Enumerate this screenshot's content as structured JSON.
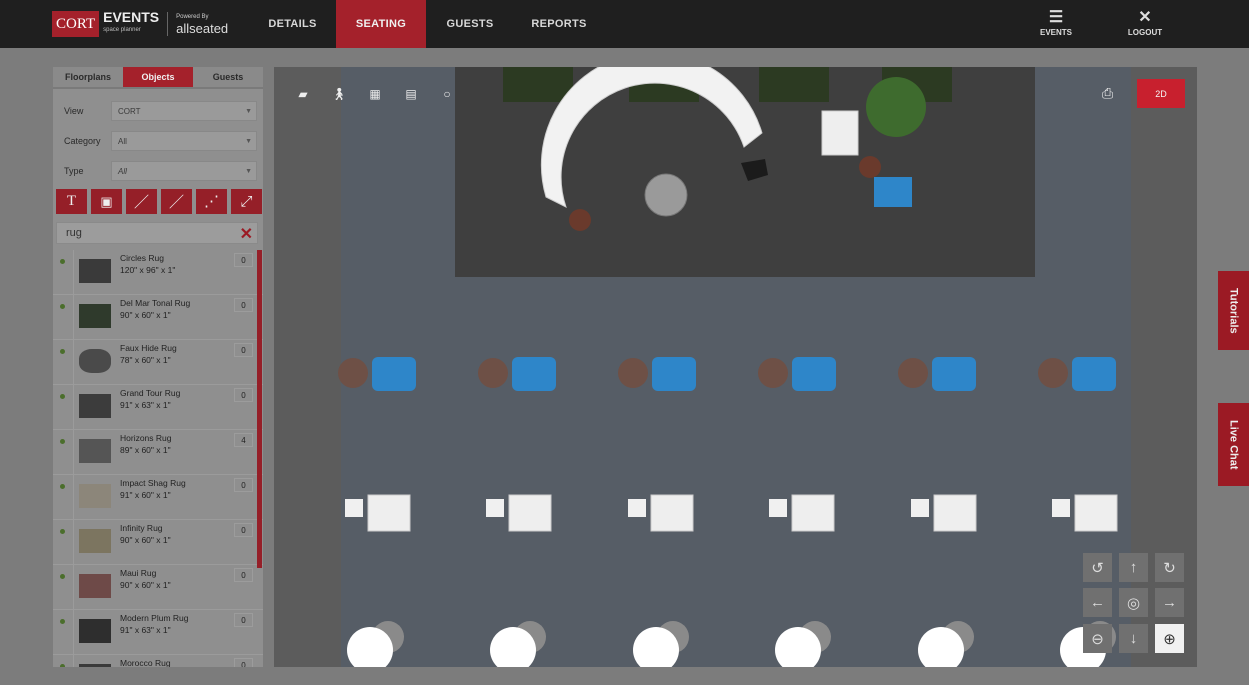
{
  "brand": {
    "logo_text": "CORT",
    "product": "EVENTS",
    "product_sub": "space planner",
    "powered_by": "Powered By",
    "partner": "allseated"
  },
  "nav": {
    "details": "DETAILS",
    "seating": "SEATING",
    "guests": "GUESTS",
    "reports": "REPORTS"
  },
  "top_actions": {
    "events": "EVENTS",
    "logout": "LOGOUT"
  },
  "panel": {
    "tabs": [
      "Floorplans",
      "Objects",
      "Guests"
    ],
    "active_tab": "Objects",
    "filters": {
      "view_label": "View",
      "view_value": "CORT",
      "category_label": "Category",
      "category_value": "All",
      "type_label": "Type",
      "type_value": "All"
    },
    "tools": [
      {
        "icon": "text-tool-icon",
        "glyph": "T"
      },
      {
        "icon": "shape-tool-icon",
        "glyph": "▣"
      },
      {
        "icon": "line-tool-icon",
        "glyph": "／"
      },
      {
        "icon": "line-tool-2-icon",
        "glyph": "／"
      },
      {
        "icon": "dots-tool-icon",
        "glyph": "⋰"
      },
      {
        "icon": "measure-tool-icon",
        "glyph": "⤢"
      }
    ],
    "search_value": "rug",
    "items": [
      {
        "name": "Circles Rug",
        "dims": "120\" x 96\" x 1\"",
        "count": "0"
      },
      {
        "name": "Del Mar Tonal Rug",
        "dims": "90\" x 60\" x 1\"",
        "count": "0"
      },
      {
        "name": "Faux Hide Rug",
        "dims": "78\" x 60\" x 1\"",
        "count": "0"
      },
      {
        "name": "Grand Tour Rug",
        "dims": "91\" x 63\" x 1\"",
        "count": "0"
      },
      {
        "name": "Horizons Rug",
        "dims": "89\" x 60\" x 1\"",
        "count": "4"
      },
      {
        "name": "Impact Shag Rug",
        "dims": "91\" x 60\" x 1\"",
        "count": "0"
      },
      {
        "name": "Infinity Rug",
        "dims": "90\" x 60\" x 1\"",
        "count": "0"
      },
      {
        "name": "Maui Rug",
        "dims": "90\" x 60\" x 1\"",
        "count": "0"
      },
      {
        "name": "Modern Plum Rug",
        "dims": "91\" x 63\" x 1\"",
        "count": "0"
      },
      {
        "name": "Morocco Rug",
        "dims": "",
        "count": "0"
      }
    ]
  },
  "canvas": {
    "view_mode": "2D",
    "tools": [
      "floor-icon",
      "walk-icon",
      "grid-icon",
      "seating-chart-icon",
      "circle-icon"
    ],
    "print_icon": "printer-icon"
  },
  "side_tabs": {
    "tutorials": "Tutorials",
    "live_chat": "Live Chat"
  },
  "colors": {
    "accent": "#a4212b",
    "button_2d": "#c8202e",
    "chair_blue": "#2e86c9"
  }
}
